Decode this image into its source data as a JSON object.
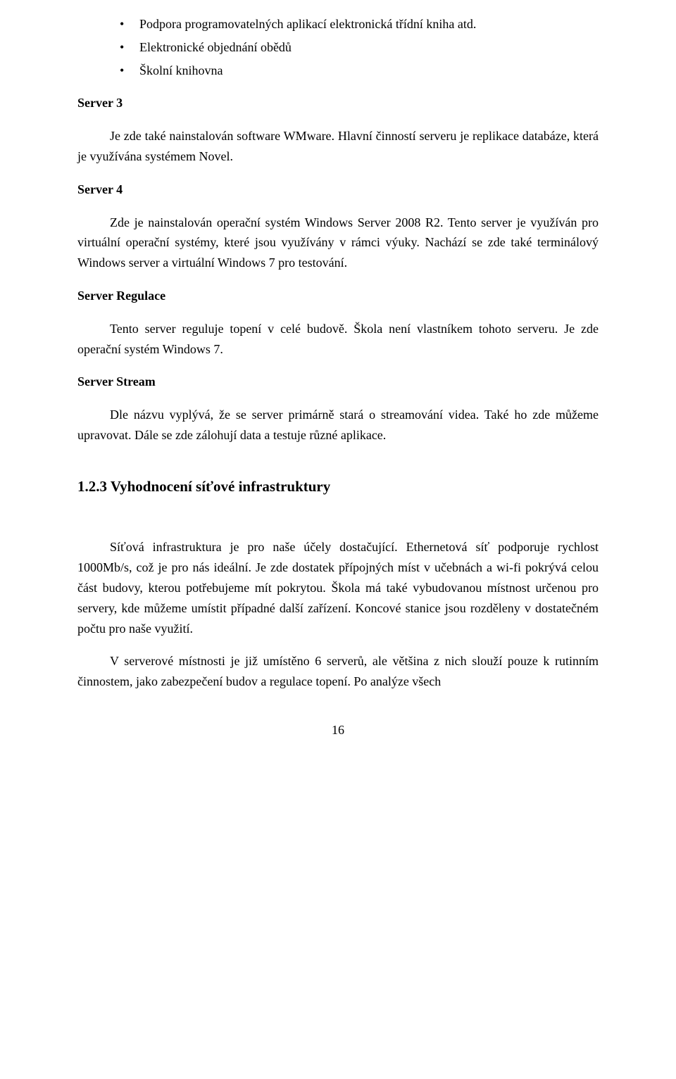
{
  "bullets": {
    "item1": "Podpora programovatelných aplikací elektronická třídní kniha atd.",
    "item2": "Elektronické objednání obědů",
    "item3": "Školní knihovna"
  },
  "server3": {
    "heading": "Server 3",
    "paragraph": "Je zde také nainstalován software WMware. Hlavní činností serveru je replikace databáze, která je využívána systémem Novel."
  },
  "server4": {
    "heading": "Server 4",
    "paragraph": "Zde je nainstalován operační systém Windows Server 2008 R2. Tento server je využíván pro virtuální operační systémy, které jsou využívány v rámci výuky. Nachází se zde také terminálový Windows server a virtuální Windows 7 pro testování."
  },
  "serverRegulace": {
    "heading": "Server Regulace",
    "paragraph": "Tento server reguluje topení v celé budově. Škola není vlastníkem tohoto serveru. Je zde operační systém Windows 7."
  },
  "serverStream": {
    "heading": "Server Stream",
    "paragraph": "Dle názvu vyplývá, že se server primárně stará o streamování videa. Také ho zde můžeme upravovat. Dále se zde zálohují data a testuje různé aplikace."
  },
  "section123": {
    "heading": "1.2.3 Vyhodnocení síťové infrastruktury",
    "paragraph1": "Síťová infrastruktura je pro naše účely dostačující. Ethernetová síť podporuje rychlost 1000Mb/s, což je pro nás ideální. Je zde dostatek přípojných míst v učebnách a wi-fi pokrývá celou část budovy, kterou potřebujeme mít pokrytou. Škola má také vybudovanou místnost určenou pro servery, kde můžeme umístit případné další zařízení. Koncové stanice jsou rozděleny v dostatečném počtu pro naše využití.",
    "paragraph2": "V serverové místnosti je již umístěno 6 serverů, ale většina z nich slouží pouze k rutinním činnostem, jako zabezpečení budov a regulace topení. Po analýze všech"
  },
  "pageNumber": "16"
}
